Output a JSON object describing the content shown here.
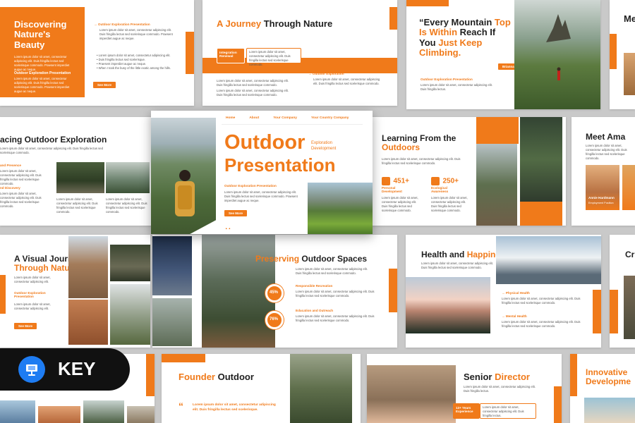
{
  "colors": {
    "accent": "#f07a1a",
    "text": "#1f1f1f",
    "background": "#c9c9c9"
  },
  "s1": {
    "title": "Discovering Nature's Beauty",
    "kicker": "Outdoor Exploration Presentation",
    "body": "Lorem ipsum dolor sit amet, consectetur adipiscing elit. Duis fringilla lectus sed scelerisque commodo. Praesent imperdiet augue ac neque.",
    "list": [
      "Lorem ipsum dolor sit amet, consectetur adipiscing elit.",
      "Duis fringilla lectus sed scelerisque.",
      "Praesent imperdiet augue ac neque.",
      "When I took the busy of the little exotic among the hills."
    ],
    "button": "See More"
  },
  "s2": {
    "title_a": "A Journey",
    "title_b": "Through Nature",
    "tag": "Integration Renewal",
    "kicker": "Outdoor Exploration",
    "body": "Lorem ipsum dolor sit amet, consectetur adipiscing elit. Duis fringilla lectus sed scelerisque commodo."
  },
  "s3": {
    "q1": "Every Mountain",
    "q2": "Top",
    "q3": "Is Within",
    "q4": "Reach If",
    "q5": "You",
    "q6": "Just Keep",
    "q7": "Climbing.",
    "author": "Brianna R. Jackson",
    "kicker": "Outdoor Exploration Presentation",
    "body": "Lorem ipsum dolor sit amet, consectetur adipiscing elit. Duis fringilla lectus."
  },
  "s4": {
    "title": "Me"
  },
  "s5": {
    "title": "acing Outdoor Exploration",
    "side1": "and Presence",
    "side2": "nd Discovery",
    "body": "Lorem ipsum dolor sit amet, consectetur adipiscing elit. Duis fringilla lectus sed scelerisque commodo."
  },
  "hero": {
    "nav": [
      "Home",
      "About",
      "Your Company",
      "Your Country Company"
    ],
    "title1": "Outdoor",
    "title2": "Presentation",
    "sub1": "Exploration",
    "sub2": "Development",
    "kicker": "Outdoor Exploration Presentation",
    "body": "Lorem ipsum dolor sit amet, consectetur adipiscing elit. Duis fringilla lectus sed scelerisque commodo. Praesent imperdiet augue ac neque.",
    "button": "See More"
  },
  "s6": {
    "title1": "Learning From the",
    "title2": "Outdoors",
    "body": "Lorem ipsum dolor sit amet, consectetur adipiscing elit. Duis fringilla lectus sed scelerisque commodo.",
    "stat1_value": "451+",
    "stat1_label": "Personal Development",
    "stat2_value": "250+",
    "stat2_label": "Ecological Awareness"
  },
  "s7": {
    "title": "Meet Ama",
    "name": "Annie Hardmann",
    "role": "Employment Position"
  },
  "s8": {
    "title1": "A Visual Journey",
    "title2": "Through Nature",
    "kicker": "Outdoor Exploration Presentation",
    "body": "Lorem ipsum dolor sit amet, consectetur adipiscing elit.",
    "button": "See More"
  },
  "s9": {
    "title_a": "Preserving",
    "title_b": "Outdoor Spaces",
    "pct1": "45%",
    "head1": "Responsible Recreation",
    "pct2": "76%",
    "head2": "Education and Outreach",
    "body": "Lorem ipsum dolor sit amet, consectetur adipiscing elit. Duis fringilla lectus sed scelerisque commodo."
  },
  "s10": {
    "title_a": "Health and",
    "title_b": "Happiness",
    "h1": "Physical Health",
    "h2": "Mental Health",
    "body": "Lorem ipsum dolor sit amet, consectetur adipiscing elit. Duis fringilla lectus sed scelerisque commodo."
  },
  "s11": {
    "title": "Cr"
  },
  "badge": {
    "label": "KEY"
  },
  "s12": {
    "title_a": "Founder",
    "title_b": "Outdoor",
    "body": "Lorem ipsum dolor sit amet, consectetur adipiscing elit. Duis fringilla lectus sed scelerisque."
  },
  "s13": {
    "title_a": "Senior",
    "title_b": "Director",
    "badge": "13+ Years Experience",
    "body": "Lorem ipsum dolor sit amet, consectetur adipiscing elit. Duis fringilla lectus."
  },
  "s14": {
    "title1": "Innovative",
    "title2": "Developme"
  }
}
